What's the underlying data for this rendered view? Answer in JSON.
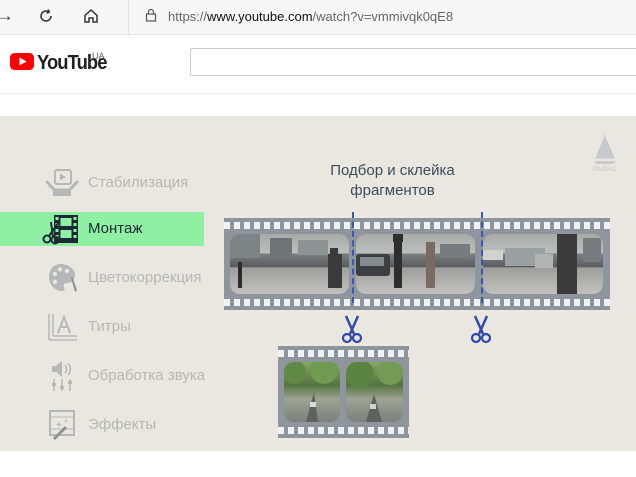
{
  "browser": {
    "url_prefix": "https://",
    "url_host": "www.youtube.com",
    "url_path": "/watch?v=vmmivqk0qE8"
  },
  "youtube": {
    "logo_text": "YouTube",
    "region": "UA",
    "search_value": ""
  },
  "video": {
    "menu": [
      {
        "label": "Стабилизация",
        "icon": "stabilization-icon",
        "active": false
      },
      {
        "label": "Монтаж",
        "icon": "film-scissors-icon",
        "active": true
      },
      {
        "label": "Цветокоррекция",
        "icon": "palette-icon",
        "active": false
      },
      {
        "label": "Титры",
        "icon": "titles-icon",
        "active": false
      },
      {
        "label": "Обработка звука",
        "icon": "audio-icon",
        "active": false
      },
      {
        "label": "Эффекты",
        "icon": "effects-icon",
        "active": false
      }
    ],
    "caption_line1": "Подбор и склейка",
    "caption_line2": "фрагментов",
    "watermark_text": "ПАЛЕКС",
    "colors": {
      "active_highlight": "#8ff0a4",
      "inactive_text": "#b6b7b8",
      "cut_line": "#3b56b5"
    }
  }
}
